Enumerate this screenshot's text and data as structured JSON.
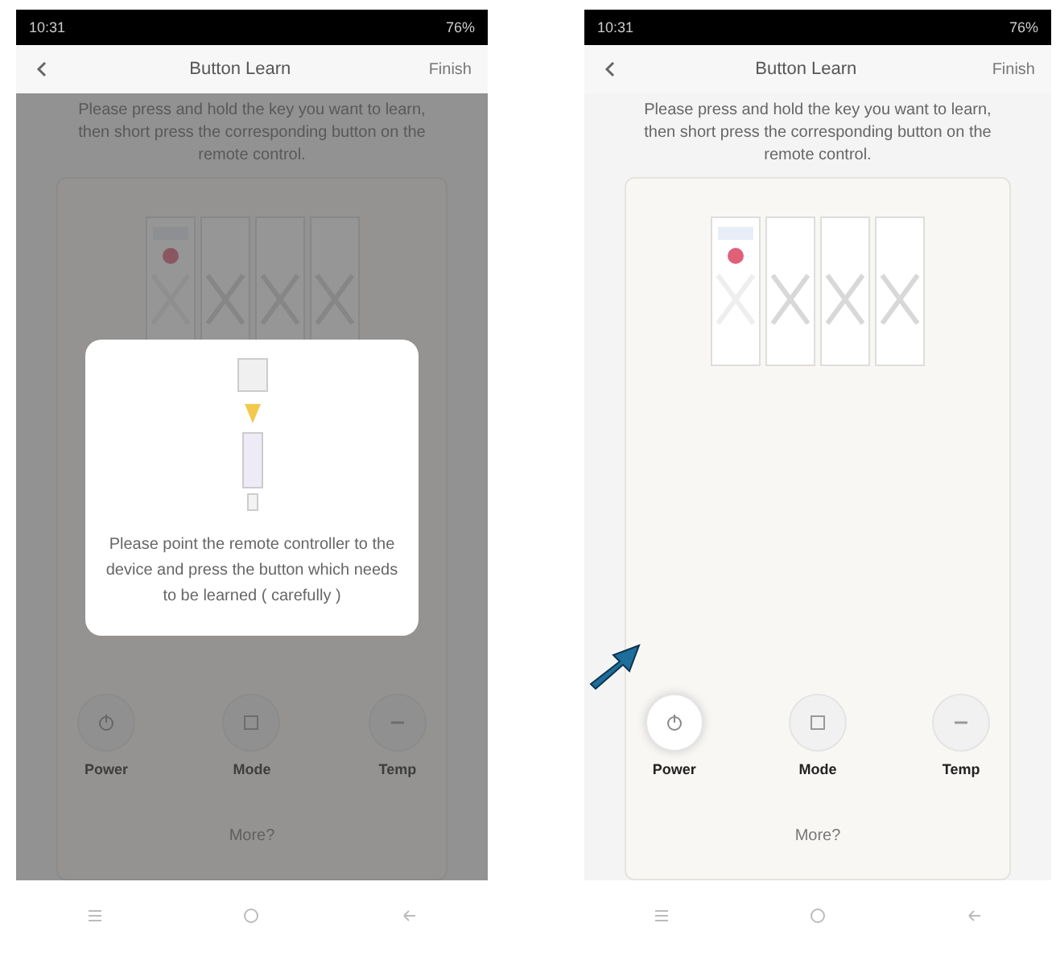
{
  "screens": [
    {
      "overlay": true,
      "status_bar": {
        "time": "10:31",
        "battery": "76%"
      },
      "header": {
        "title": "Button Learn",
        "action": "Finish"
      },
      "instruction": "Please press and hold the key you want to learn, then short press the corresponding button on the remote control.",
      "buttons": [
        {
          "label": "Power"
        },
        {
          "label": "Mode"
        },
        {
          "label": "Temp"
        }
      ],
      "more": "More?",
      "dialog": {
        "message": "Please point the remote controller to the device and press the button which needs to be learned ( carefully )"
      }
    },
    {
      "overlay": false,
      "status_bar": {
        "time": "10:31",
        "battery": "76%"
      },
      "header": {
        "title": "Button Learn",
        "action": "Finish"
      },
      "instruction": "Please press and hold the key you want to learn, then short press the corresponding button on the remote control.",
      "buttons": [
        {
          "label": "Power",
          "highlighted": true
        },
        {
          "label": "Mode",
          "highlighted": false
        },
        {
          "label": "Temp",
          "highlighted": false
        }
      ],
      "more": "More?"
    }
  ]
}
